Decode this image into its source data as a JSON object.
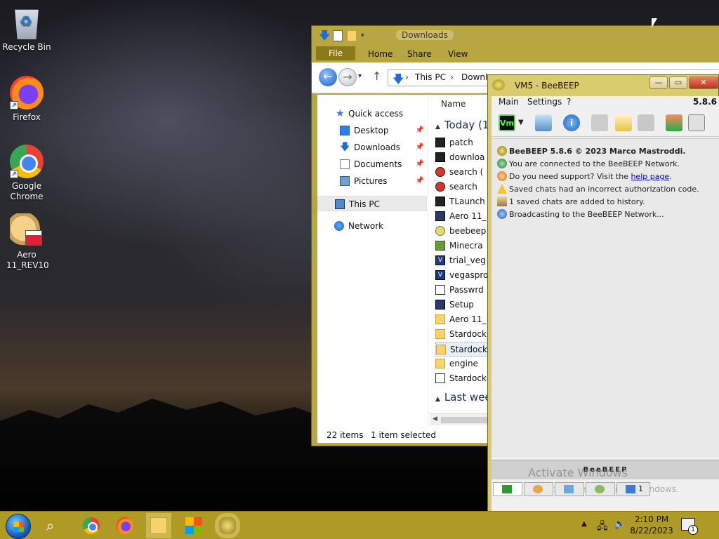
{
  "desktop": {
    "icons": [
      {
        "label": "Recycle Bin",
        "icon": "recycle-bin-icon"
      },
      {
        "label": "Firefox",
        "icon": "firefox-icon"
      },
      {
        "label": "Google Chrome",
        "icon": "chrome-icon"
      },
      {
        "label": "Aero 11_REV10",
        "icon": "aero-icon"
      }
    ]
  },
  "explorer": {
    "title": "Downloads",
    "ribbon_tabs": [
      "File",
      "Home",
      "Share",
      "View"
    ],
    "address": {
      "root": "This PC",
      "current": "Downlo"
    },
    "nav": {
      "items": [
        {
          "label": "Quick access",
          "pinned": false
        },
        {
          "label": "Desktop",
          "pinned": true
        },
        {
          "label": "Downloads",
          "pinned": true
        },
        {
          "label": "Documents",
          "pinned": true
        },
        {
          "label": "Pictures",
          "pinned": true
        },
        {
          "label": "This PC",
          "pinned": false
        },
        {
          "label": "Network",
          "pinned": false
        }
      ]
    },
    "column_header": "Name",
    "groups": [
      "Today (1",
      "Last wee"
    ],
    "files": [
      "patch",
      "downloa",
      "search (",
      "search",
      "TLaunch",
      "Aero 11_",
      "beebeep",
      "Minecra",
      "trial_veg",
      "vegaspro",
      "Passwrd",
      "Setup",
      "Aero 11_",
      "Stardock",
      "Stardock",
      "engine",
      "Stardock"
    ],
    "status": {
      "items": "22 items",
      "selected": "1 item selected"
    }
  },
  "beebeep": {
    "title": "VM5 - BeeBEEP",
    "menus": [
      "Main",
      "Settings",
      "?"
    ],
    "version": "5.8.6",
    "toolbar_vm_label": "Vm",
    "messages": {
      "m1": "BeeBEEP 5.8.6 © 2023 Marco Mastroddi.",
      "m2": "You are connected to the BeeBEEP Network.",
      "m3_prefix": "Do you need support? Visit the ",
      "m3_link": "help page",
      "m3_suffix": ".",
      "m4": "Saved chats had an incorrect authorization code.",
      "m5": "1 saved chats are added to history.",
      "m6": "Broadcasting to the BeeBEEP Network..."
    },
    "input_logo": "BeeBEEP",
    "watermark": {
      "line1": "Activate Windows",
      "line2": "Go to Settings to activate Windows."
    },
    "tabs_share_count": "1"
  },
  "taskbar": {
    "clock_time": "2:10 PM",
    "clock_date": "8/22/2023",
    "notification_count": "1"
  },
  "colors": {
    "accent": "#b09a26",
    "bee_frame": "#d9cc6c",
    "link": "#0000cc"
  }
}
